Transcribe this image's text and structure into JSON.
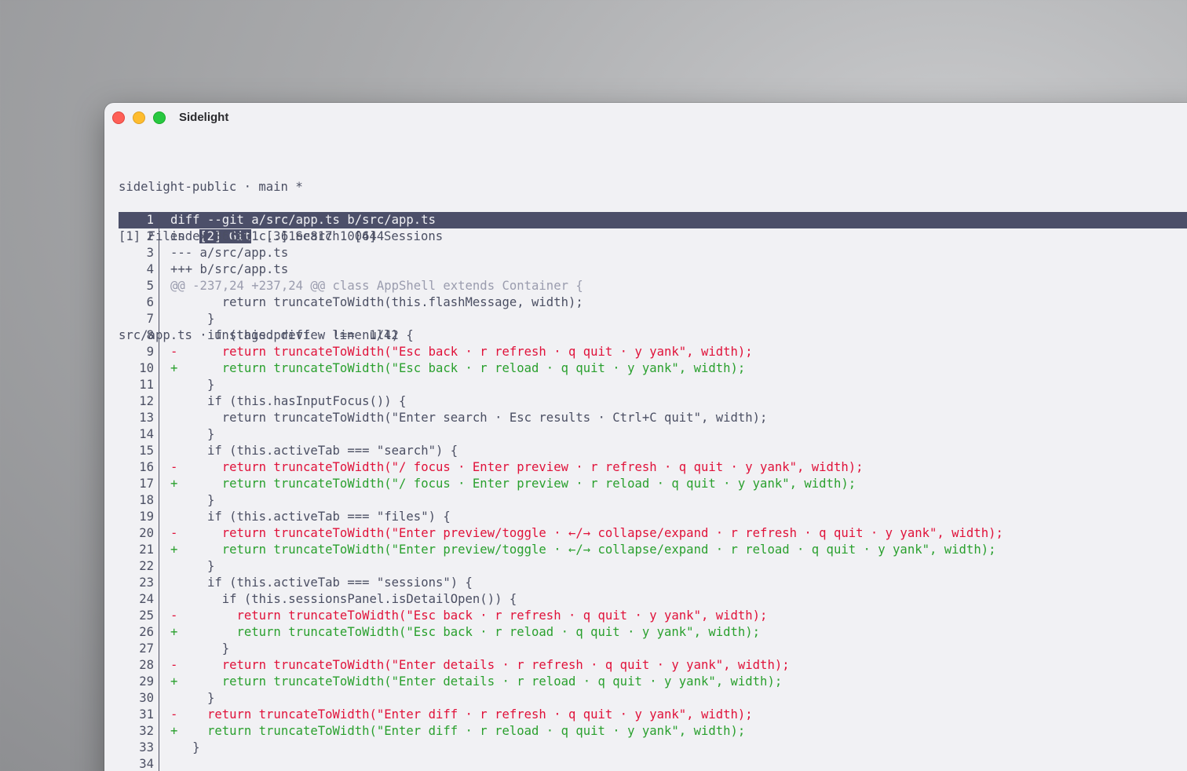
{
  "window": {
    "title": "Sidelight"
  },
  "header": {
    "repo_line": "sidelight-public · main *",
    "tabs": [
      {
        "label": "[1] Files",
        "active": false
      },
      {
        "label": "[2] Git",
        "active": true
      },
      {
        "label": "[3] Search",
        "active": false
      },
      {
        "label": "[4] Sessions",
        "active": false
      }
    ],
    "file_status": "src/app.ts · unstaged diff · line 1/42"
  },
  "colors": {
    "accent": "#4c4f69",
    "removed": "#e0123a",
    "added": "#2aa02e",
    "hunk": "#9a9cae"
  },
  "diff": {
    "lines": [
      {
        "n": "1",
        "kind": "active",
        "text": "diff --git a/src/app.ts b/src/app.ts"
      },
      {
        "n": "2",
        "kind": "meta",
        "text": "index 861a01c..61ec817 100644"
      },
      {
        "n": "3",
        "kind": "meta",
        "text": "--- a/src/app.ts"
      },
      {
        "n": "4",
        "kind": "meta",
        "text": "+++ b/src/app.ts"
      },
      {
        "n": "5",
        "kind": "hunk",
        "text": "@@ -237,24 +237,24 @@ class AppShell extends Container {"
      },
      {
        "n": "6",
        "kind": "ctx",
        "text": "       return truncateToWidth(this.flashMessage, width);"
      },
      {
        "n": "7",
        "kind": "ctx",
        "text": "     }"
      },
      {
        "n": "8",
        "kind": "ctx",
        "text": "     if (this.preview !== null) {"
      },
      {
        "n": "9",
        "kind": "del",
        "text": "-      return truncateToWidth(\"Esc back · r refresh · q quit · y yank\", width);"
      },
      {
        "n": "10",
        "kind": "add",
        "text": "+      return truncateToWidth(\"Esc back · r reload · q quit · y yank\", width);"
      },
      {
        "n": "11",
        "kind": "ctx",
        "text": "     }"
      },
      {
        "n": "12",
        "kind": "ctx",
        "text": "     if (this.hasInputFocus()) {"
      },
      {
        "n": "13",
        "kind": "ctx",
        "text": "       return truncateToWidth(\"Enter search · Esc results · Ctrl+C quit\", width);"
      },
      {
        "n": "14",
        "kind": "ctx",
        "text": "     }"
      },
      {
        "n": "15",
        "kind": "ctx",
        "text": "     if (this.activeTab === \"search\") {"
      },
      {
        "n": "16",
        "kind": "del",
        "text": "-      return truncateToWidth(\"/ focus · Enter preview · r refresh · q quit · y yank\", width);"
      },
      {
        "n": "17",
        "kind": "add",
        "text": "+      return truncateToWidth(\"/ focus · Enter preview · r reload · q quit · y yank\", width);"
      },
      {
        "n": "18",
        "kind": "ctx",
        "text": "     }"
      },
      {
        "n": "19",
        "kind": "ctx",
        "text": "     if (this.activeTab === \"files\") {"
      },
      {
        "n": "20",
        "kind": "del",
        "text": "-      return truncateToWidth(\"Enter preview/toggle · ←/→ collapse/expand · r refresh · q quit · y yank\", width);"
      },
      {
        "n": "21",
        "kind": "add",
        "text": "+      return truncateToWidth(\"Enter preview/toggle · ←/→ collapse/expand · r reload · q quit · y yank\", width);"
      },
      {
        "n": "22",
        "kind": "ctx",
        "text": "     }"
      },
      {
        "n": "23",
        "kind": "ctx",
        "text": "     if (this.activeTab === \"sessions\") {"
      },
      {
        "n": "24",
        "kind": "ctx",
        "text": "       if (this.sessionsPanel.isDetailOpen()) {"
      },
      {
        "n": "25",
        "kind": "del",
        "text": "-        return truncateToWidth(\"Esc back · r refresh · q quit · y yank\", width);"
      },
      {
        "n": "26",
        "kind": "add",
        "text": "+        return truncateToWidth(\"Esc back · r reload · q quit · y yank\", width);"
      },
      {
        "n": "27",
        "kind": "ctx",
        "text": "       }"
      },
      {
        "n": "28",
        "kind": "del",
        "text": "-      return truncateToWidth(\"Enter details · r refresh · q quit · y yank\", width);"
      },
      {
        "n": "29",
        "kind": "add",
        "text": "+      return truncateToWidth(\"Enter details · r reload · q quit · y yank\", width);"
      },
      {
        "n": "30",
        "kind": "ctx",
        "text": "     }"
      },
      {
        "n": "31",
        "kind": "del",
        "text": "-    return truncateToWidth(\"Enter diff · r refresh · q quit · y yank\", width);"
      },
      {
        "n": "32",
        "kind": "add",
        "text": "+    return truncateToWidth(\"Enter diff · r reload · q quit · y yank\", width);"
      },
      {
        "n": "33",
        "kind": "ctx",
        "text": "   }"
      },
      {
        "n": "34",
        "kind": "ctx",
        "text": ""
      }
    ]
  }
}
